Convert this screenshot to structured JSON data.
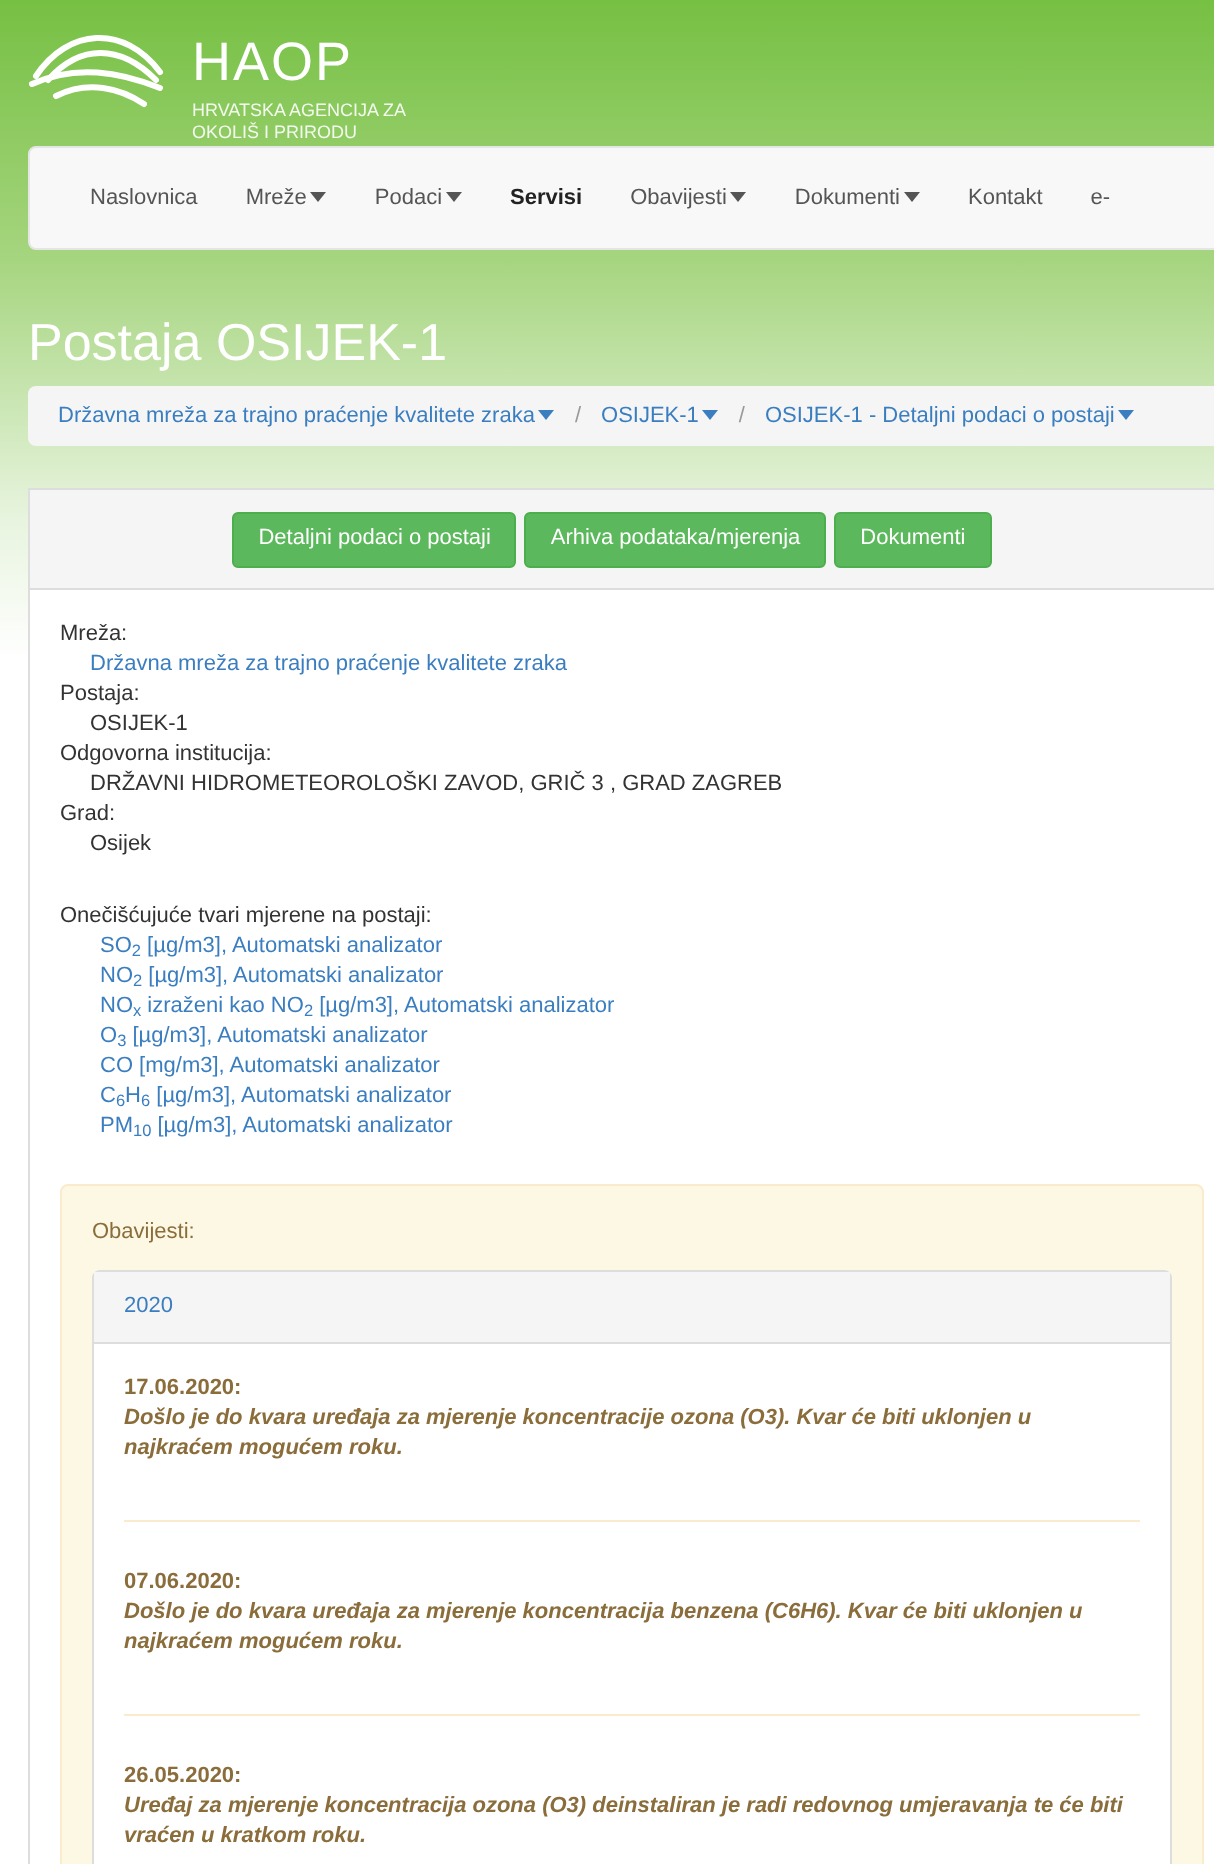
{
  "logo": {
    "name": "HAOP",
    "subtitle_lines": [
      "HRVATSKA AGENCIJA ZA",
      "OKOLIŠ I PRIRODU"
    ]
  },
  "nav": [
    {
      "label": "Naslovnica",
      "has_menu": false,
      "selected": false
    },
    {
      "label": "Mreže",
      "has_menu": true,
      "selected": false
    },
    {
      "label": "Podaci",
      "has_menu": true,
      "selected": false
    },
    {
      "label": "Servisi",
      "has_menu": false,
      "selected": true
    },
    {
      "label": "Obavijesti",
      "has_menu": true,
      "selected": false
    },
    {
      "label": "Dokumenti",
      "has_menu": true,
      "selected": false
    },
    {
      "label": "Kontakt",
      "has_menu": false,
      "selected": false
    },
    {
      "label": "e-",
      "has_menu": false,
      "selected": false
    }
  ],
  "page_title": "Postaja OSIJEK-1",
  "breadcrumb": [
    {
      "label": "Državna mreža za trajno praćenje kvalitete zraka",
      "has_menu": true
    },
    {
      "label": "OSIJEK-1",
      "has_menu": true
    },
    {
      "label": "OSIJEK-1 - Detaljni podaci o postaji",
      "has_menu": true
    }
  ],
  "breadcrumb_separator": "/",
  "buttons": [
    "Detaljni podaci o postaji",
    "Arhiva podataka/mjerenja",
    "Dokumenti"
  ],
  "details": [
    {
      "label": "Mreža:",
      "value": "Državna mreža za trajno praćenje kvalitete zraka",
      "kind": "link"
    },
    {
      "label": "Postaja:",
      "value": "OSIJEK-1",
      "kind": "text"
    },
    {
      "label": "Odgovorna institucija:",
      "value": "DRŽAVNI HIDROMETEOROLOŠKI ZAVOD, GRIČ 3 , GRAD ZAGREB",
      "kind": "text"
    },
    {
      "label": "Grad:",
      "value": "Osijek",
      "kind": "text"
    }
  ],
  "pollutants_label": "Onečišćujuće tvari mjerene na postaji:",
  "pollutants": [
    "SO$_{2}$ [µg/m3], Automatski analizator",
    "NO$_{2}$ [µg/m3], Automatski analizator",
    "NO$_{x}$ izraženi kao NO$_{2}$ [µg/m3], Automatski analizator",
    "O$_{3}$ [µg/m3], Automatski analizator",
    "CO [mg/m3], Automatski analizator",
    "C$_{6}$H$_{6}$ [µg/m3], Automatski analizator",
    "PM$_{10}$ [µg/m3], Automatski analizator"
  ],
  "notices": {
    "title": "Obavijesti:",
    "year": "2020",
    "items": [
      {
        "date": "17.06.2020:",
        "text": "Došlo je do kvara uređaja za mjerenje koncentracije ozona (O3). Kvar će biti uklonjen u najkraćem mogućem roku."
      },
      {
        "date": "07.06.2020:",
        "text": "Došlo je do kvara uređaja za mjerenje koncentracija benzena (C6H6). Kvar će biti uklonjen u najkraćem mogućem roku."
      },
      {
        "date": "26.05.2020:",
        "text": "Uređaj za mjerenje koncentracija ozona (O3) deinstaliran je radi redovnog umjeravanja te će biti vraćen u kratkom roku."
      }
    ]
  }
}
